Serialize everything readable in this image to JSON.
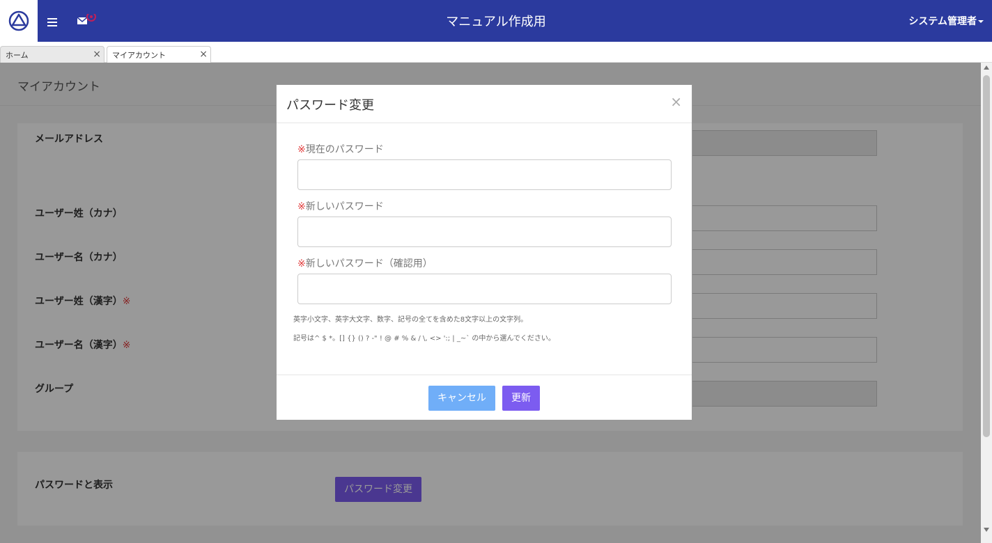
{
  "header": {
    "app_title": "マニュアル作成用",
    "user_menu": "システム管理者"
  },
  "tabs": [
    {
      "label": "ホーム",
      "close": "×"
    },
    {
      "label": "マイアカウント",
      "close": "×"
    }
  ],
  "page": {
    "title": "マイアカウント",
    "fields": [
      {
        "label": "メールアドレス",
        "required": ""
      },
      {
        "label": "ユーザー姓（カナ）",
        "required": ""
      },
      {
        "label": "ユーザー名（カナ）",
        "required": ""
      },
      {
        "label": "ユーザー姓（漢字）",
        "required": "※"
      },
      {
        "label": "ユーザー名（漢字）",
        "required": "※"
      },
      {
        "label": "グループ",
        "required": ""
      }
    ],
    "password_section_label": "パスワードと表示",
    "password_change_button": "パスワード変更"
  },
  "modal": {
    "title": "パスワード変更",
    "close": "×",
    "required_mark": "※",
    "current_password_label": "現在のパスワード",
    "new_password_label": "新しいパスワード",
    "confirm_password_label": "新しいパスワード（確認用）",
    "note1": "英字小文字、英字大文字、数字、記号の全てを含めた8文字以上の文字列。",
    "note2": "記号は^ $ *。[] {} () ? -\" ! @ # % & / \\, <> ':; | _~` の中から選んでください。",
    "cancel_button": "キャンセル",
    "update_button": "更新"
  },
  "colors": {
    "header_bg": "#2b3a9e",
    "primary_button": "#7c5cf0",
    "cancel_button": "#70aef8",
    "required": "#e23b3b"
  }
}
